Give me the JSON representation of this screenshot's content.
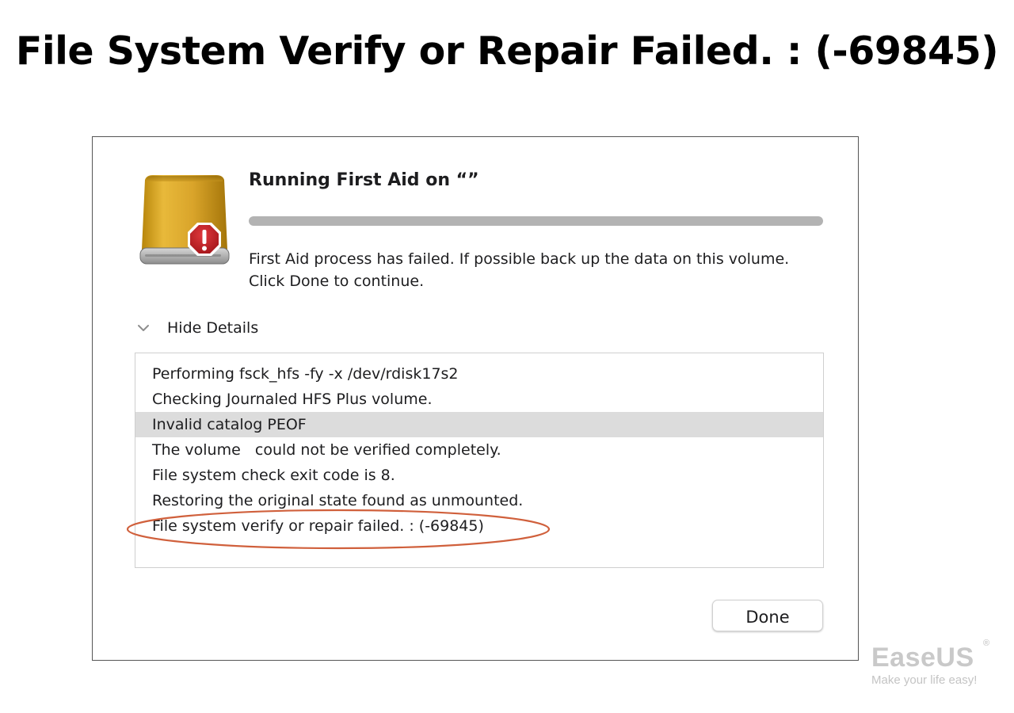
{
  "headline": "File System Verify or Repair Failed. : (-69845)",
  "dialog": {
    "title": "Running First Aid on “”",
    "icon": "external-drive-with-error-badge-icon",
    "progress": 1.0,
    "message": "First Aid process has failed. If possible back up the data on this volume. Click Done to continue.",
    "details_toggle_label": "Hide Details",
    "details_expanded": true,
    "log_lines": [
      "Performing fsck_hfs -fy -x /dev/rdisk17s2",
      "Checking Journaled HFS Plus volume.",
      "Invalid catalog PEOF",
      "The volume   could not be verified completely.",
      "File system check exit code is 8.",
      "Restoring the original state found as unmounted.",
      "File system verify or repair failed. : (-69845)"
    ],
    "highlighted_line_index": 2,
    "circled_line_index": 6,
    "done_button_label": "Done"
  },
  "brand": {
    "name": "EaseUS",
    "registered_mark": "®",
    "tagline": "Make your life easy!"
  },
  "colors": {
    "drive_gold": "#d9a82a",
    "error_red": "#c0262c",
    "annotation_circle": "#d0603c",
    "progress_fill": "#b3b3b3",
    "highlight_row": "#dcdcdc"
  }
}
